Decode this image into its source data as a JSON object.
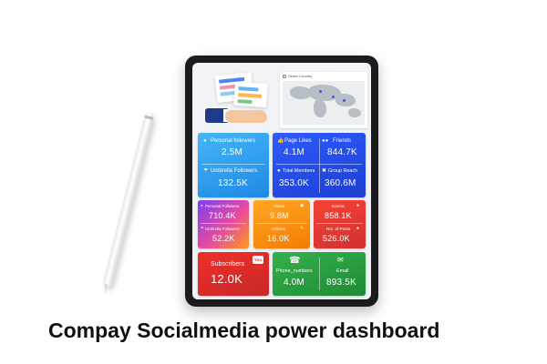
{
  "caption": "Compay Socialmedia power dashboard",
  "map": {
    "title": "Select Country"
  },
  "tiles": {
    "personal": {
      "followers_label": "Personal followers",
      "followers_value": "2.5M",
      "umbrella_label": "Umbrella Followers",
      "umbrella_value": "132.5K",
      "icon_top": "user-icon",
      "icon_bottom": "umbrella-icon"
    },
    "pages": {
      "likes_label": "Page Likes",
      "likes_value": "4.1M",
      "friends_label": "Friends",
      "friends_value": "844.7K",
      "members_label": "Total Members",
      "members_value": "353.0K",
      "reach_label": "Group Reach",
      "reach_value": "360.6M"
    },
    "gradient": {
      "personal_label": "Personal Followers",
      "personal_value": "710.4K",
      "umbrella_label": "Umbrella Followers",
      "umbrella_value": "52.2K"
    },
    "views": {
      "views_label": "Views",
      "views_value": "9.8M",
      "articles_label": "Articles",
      "articles_value": "16.0K"
    },
    "karma": {
      "karma_label": "Karma",
      "karma_value": "858.1K",
      "posts_label": "NO. of Posts",
      "posts_value": "526.0K"
    },
    "subscribers": {
      "label": "Subscribers",
      "value": "12.0K",
      "badge": "You Tube"
    },
    "contact": {
      "phone_label": "Phone_numbers",
      "phone_value": "4.0M",
      "email_label": "Email",
      "email_value": "893.5K"
    }
  },
  "colors": {
    "blue_light": "#1e88e5",
    "blue_dark": "#1d3fd0",
    "orange": "#f57c00",
    "red": "#d32f2f",
    "green": "#1f8a36"
  }
}
